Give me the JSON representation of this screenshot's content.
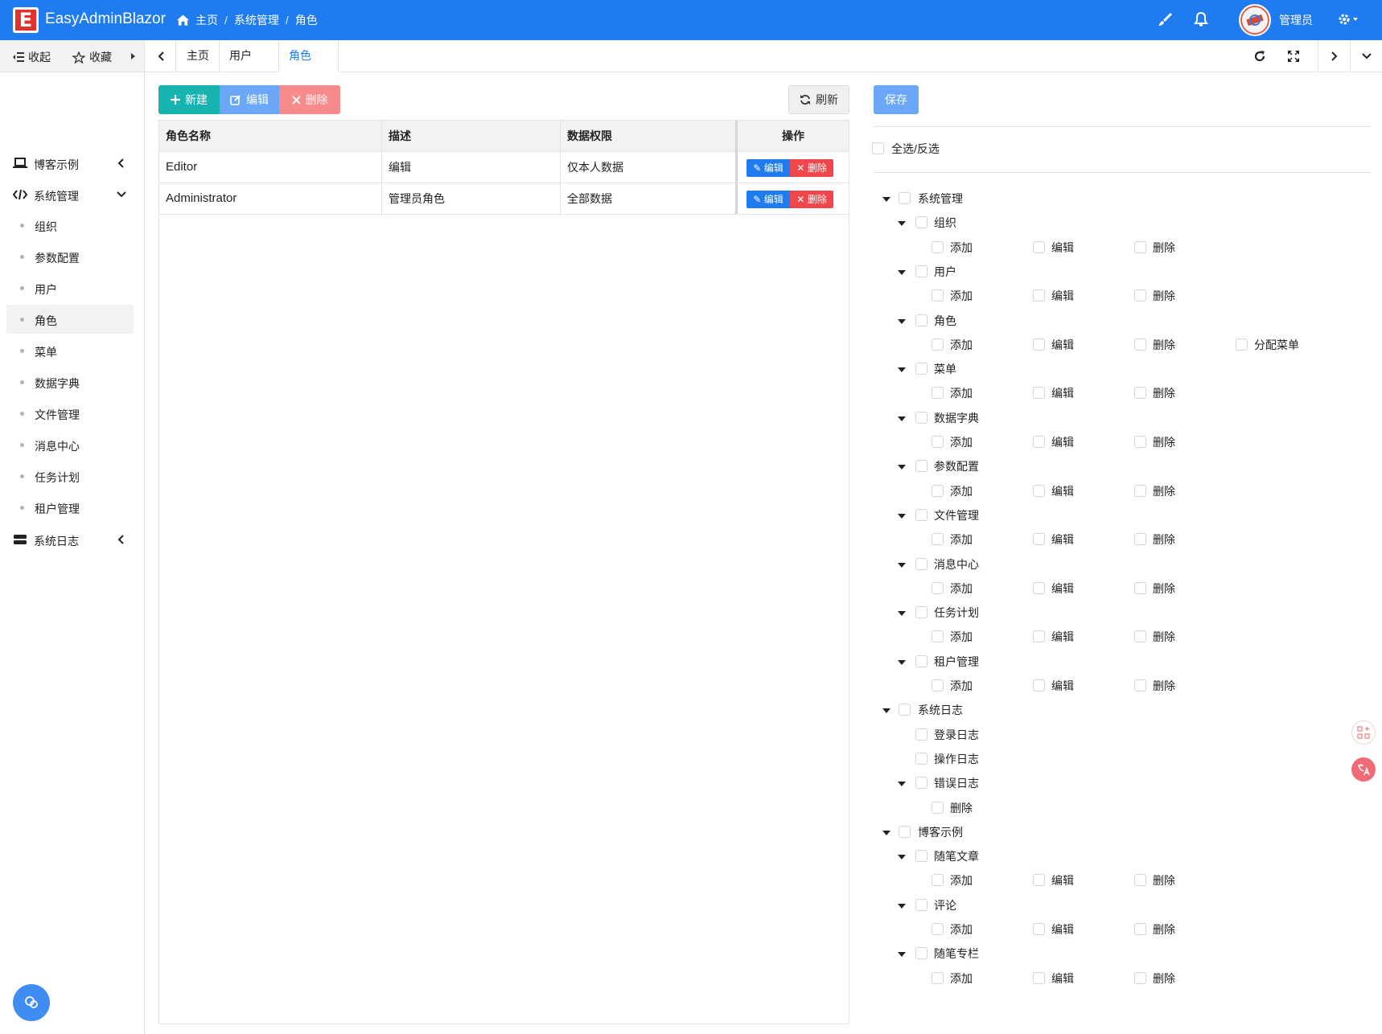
{
  "header": {
    "app_title": "EasyAdminBlazor",
    "logo_letter": "E",
    "breadcrumbs": [
      "主页",
      "系统管理",
      "角色"
    ],
    "breadcrumb_sep": "/",
    "user_name": "管理员",
    "accent": "#1e7cf0"
  },
  "tabbar": {
    "collapse_label": "收起",
    "favorites_label": "收藏",
    "tabs": [
      "主页",
      "用户",
      "角色"
    ],
    "active_tab": "角色"
  },
  "sidebar": {
    "groups": [
      {
        "label": "博客示例",
        "icon": "laptop-icon",
        "expanded": false
      },
      {
        "label": "系统管理",
        "icon": "code-icon",
        "expanded": true
      },
      {
        "label": "系统日志",
        "icon": "server-icon",
        "expanded": false
      }
    ],
    "sub_items": [
      "组织",
      "参数配置",
      "用户",
      "角色",
      "菜单",
      "数据字典",
      "文件管理",
      "消息中心",
      "任务计划",
      "租户管理"
    ],
    "active_item": "角色"
  },
  "toolbar": {
    "new_label": "新建",
    "edit_label": "编辑",
    "delete_label": "删除",
    "refresh_label": "刷新",
    "save_label": "保存"
  },
  "table": {
    "columns": [
      "角色名称",
      "描述",
      "数据权限",
      "操作"
    ],
    "rows": [
      {
        "name": "Editor",
        "desc": "编辑",
        "scope": "仅本人数据"
      },
      {
        "name": "Administrator",
        "desc": "管理员角色",
        "scope": "全部数据"
      }
    ],
    "row_edit_label": "编辑",
    "row_delete_label": "删除"
  },
  "permissions": {
    "select_all_label": "全选/反选",
    "tree": [
      {
        "label": "系统管理",
        "children": [
          {
            "label": "组织",
            "actions": [
              "添加",
              "编辑",
              "删除"
            ]
          },
          {
            "label": "用户",
            "actions": [
              "添加",
              "编辑",
              "删除"
            ]
          },
          {
            "label": "角色",
            "actions": [
              "添加",
              "编辑",
              "删除",
              "分配菜单"
            ]
          },
          {
            "label": "菜单",
            "actions": [
              "添加",
              "编辑",
              "删除"
            ]
          },
          {
            "label": "数据字典",
            "actions": [
              "添加",
              "编辑",
              "删除"
            ]
          },
          {
            "label": "参数配置",
            "actions": [
              "添加",
              "编辑",
              "删除"
            ]
          },
          {
            "label": "文件管理",
            "actions": [
              "添加",
              "编辑",
              "删除"
            ]
          },
          {
            "label": "消息中心",
            "actions": [
              "添加",
              "编辑",
              "删除"
            ]
          },
          {
            "label": "任务计划",
            "actions": [
              "添加",
              "编辑",
              "删除"
            ]
          },
          {
            "label": "租户管理",
            "actions": [
              "添加",
              "编辑",
              "删除"
            ]
          }
        ]
      },
      {
        "label": "系统日志",
        "children": [
          {
            "label": "登录日志",
            "actions": []
          },
          {
            "label": "操作日志",
            "actions": []
          },
          {
            "label": "错误日志",
            "actions": [
              "删除"
            ]
          }
        ]
      },
      {
        "label": "博客示例",
        "children": [
          {
            "label": "随笔文章",
            "actions": [
              "添加",
              "编辑",
              "删除"
            ]
          },
          {
            "label": "评论",
            "actions": [
              "添加",
              "编辑",
              "删除"
            ]
          },
          {
            "label": "随笔专栏",
            "actions": [
              "添加",
              "编辑",
              "删除"
            ]
          }
        ]
      }
    ]
  }
}
